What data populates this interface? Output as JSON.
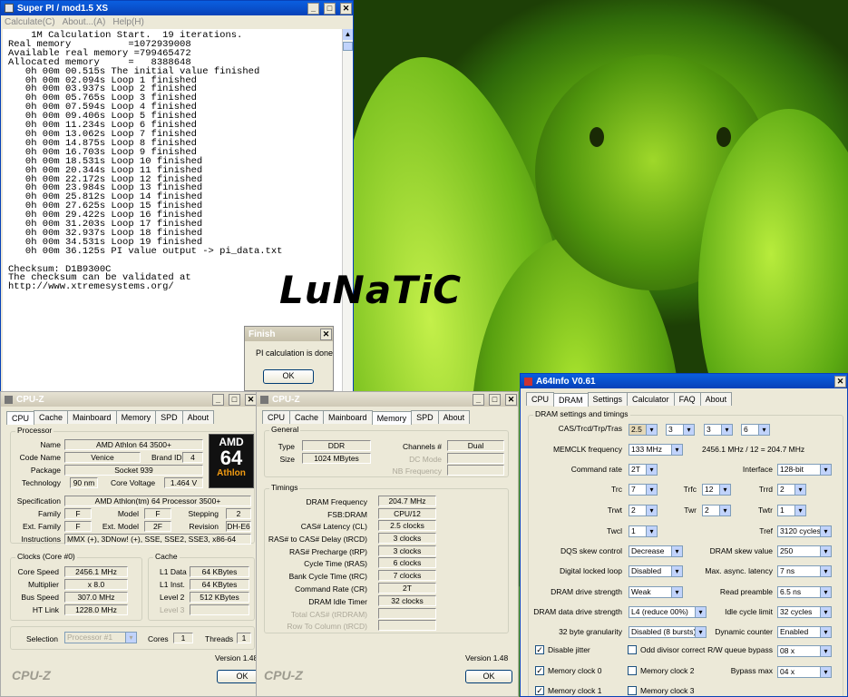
{
  "overlay_text": "LuNaTiC",
  "superpi": {
    "title": "Super PI / mod1.5 XS",
    "menu": [
      "Calculate(C)",
      "About...(A)",
      "Help(H)"
    ],
    "log": "    1M Calculation Start.  19 iterations.\nReal memory          =1072939008\nAvailable real memory =799465472\nAllocated memory     =   8388648\n   0h 00m 00.515s The initial value finished\n   0h 00m 02.094s Loop 1 finished\n   0h 00m 03.937s Loop 2 finished\n   0h 00m 05.765s Loop 3 finished\n   0h 00m 07.594s Loop 4 finished\n   0h 00m 09.406s Loop 5 finished\n   0h 00m 11.234s Loop 6 finished\n   0h 00m 13.062s Loop 7 finished\n   0h 00m 14.875s Loop 8 finished\n   0h 00m 16.703s Loop 9 finished\n   0h 00m 18.531s Loop 10 finished\n   0h 00m 20.344s Loop 11 finished\n   0h 00m 22.172s Loop 12 finished\n   0h 00m 23.984s Loop 13 finished\n   0h 00m 25.812s Loop 14 finished\n   0h 00m 27.625s Loop 15 finished\n   0h 00m 29.422s Loop 16 finished\n   0h 00m 31.203s Loop 17 finished\n   0h 00m 32.937s Loop 18 finished\n   0h 00m 34.531s Loop 19 finished\n   0h 00m 36.125s PI value output -> pi_data.txt\n\nChecksum: D1B9300C\nThe checksum can be validated at\nhttp://www.xtremesystems.org/"
  },
  "finish_dialog": {
    "title": "Finish",
    "message": "PI calculation is done!",
    "ok": "OK"
  },
  "cpuz1": {
    "title": "CPU-Z",
    "tabs": [
      "CPU",
      "Cache",
      "Mainboard",
      "Memory",
      "SPD",
      "About"
    ],
    "processor_group": "Processor",
    "name_label": "Name",
    "name": "AMD Athlon 64 3500+",
    "codename_label": "Code Name",
    "codename": "Venice",
    "brandid_label": "Brand ID",
    "brandid": "4",
    "package_label": "Package",
    "package": "Socket 939",
    "tech_label": "Technology",
    "tech": "90 nm",
    "voltage_label": "Core Voltage",
    "voltage": "1.464 V",
    "spec_label": "Specification",
    "spec": "AMD Athlon(tm) 64 Processor 3500+",
    "family_label": "Family",
    "family": "F",
    "model_label": "Model",
    "model": "F",
    "stepping_label": "Stepping",
    "stepping": "2",
    "extfamily_label": "Ext. Family",
    "extfamily": "F",
    "extmodel_label": "Ext. Model",
    "extmodel": "2F",
    "revision_label": "Revision",
    "revision": "DH-E6",
    "instr_label": "Instructions",
    "instr": "MMX (+), 3DNow! (+), SSE, SSE2, SSE3, x86-64",
    "clocks_group": "Clocks (Core #0)",
    "corespeed_label": "Core Speed",
    "corespeed": "2456.1 MHz",
    "mult_label": "Multiplier",
    "mult": "x 8.0",
    "bus_label": "Bus Speed",
    "bus": "307.0 MHz",
    "ht_label": "HT Link",
    "ht": "1228.0 MHz",
    "cache_group": "Cache",
    "l1d_label": "L1 Data",
    "l1d": "64 KBytes",
    "l1i_label": "L1 Inst.",
    "l1i": "64 KBytes",
    "l2_label": "Level 2",
    "l2": "512 KBytes",
    "l3_label": "Level 3",
    "selection_label": "Selection",
    "selection": "Processor #1",
    "cores_label": "Cores",
    "cores": "1",
    "threads_label": "Threads",
    "threads": "1",
    "version": "Version 1.48",
    "brand_logo": "CPU-Z",
    "ok": "OK",
    "amd_text": "AMD",
    "amd_num": "64",
    "amd_athlon": "Athlon"
  },
  "cpuz2": {
    "title": "CPU-Z",
    "tabs": [
      "CPU",
      "Cache",
      "Mainboard",
      "Memory",
      "SPD",
      "About"
    ],
    "general_group": "General",
    "type_label": "Type",
    "type": "DDR",
    "size_label": "Size",
    "size": "1024 MBytes",
    "channels_label": "Channels #",
    "channels": "Dual",
    "dcmode_label": "DC Mode",
    "nbfreq_label": "NB Frequency",
    "timings_group": "Timings",
    "dramfreq_label": "DRAM Frequency",
    "dramfreq": "204.7 MHz",
    "fsb_label": "FSB:DRAM",
    "fsb": "CPU/12",
    "cas_label": "CAS# Latency (CL)",
    "cas": "2.5 clocks",
    "trcd_label": "RAS# to CAS# Delay (tRCD)",
    "trcd": "3 clocks",
    "trp_label": "RAS# Precharge (tRP)",
    "trp": "3 clocks",
    "tras_label": "Cycle Time (tRAS)",
    "tras": "6 clocks",
    "trc_label": "Bank Cycle Time (tRC)",
    "trc": "7 clocks",
    "cr_label": "Command Rate (CR)",
    "cr": "2T",
    "idle_label": "DRAM Idle Timer",
    "idle": "32 clocks",
    "tcas_label": "Total CAS# (tRDRAM)",
    "rowcol_label": "Row To Column (tRCD)",
    "version": "Version 1.48",
    "brand_logo": "CPU-Z",
    "ok": "OK"
  },
  "a64": {
    "title": "A64Info V0.61",
    "tabs": [
      "CPU",
      "DRAM",
      "Settings",
      "Calculator",
      "FAQ",
      "About"
    ],
    "group": "DRAM settings and timings",
    "cas_label": "CAS/Trcd/Trp/Tras",
    "cas": "2.5",
    "trcd": "3",
    "trp": "3",
    "tras": "6",
    "memclk_label": "MEMCLK frequency",
    "memclk": "133 MHz",
    "memclk_calc": "2456.1 MHz / 12 = 204.7 MHz",
    "cmdrate_label": "Command rate",
    "cmdrate": "2T",
    "interface_label": "Interface",
    "interface": "128-bit",
    "trc_label": "Trc",
    "trc": "7",
    "trfc_label": "Trfc",
    "trfc": "12",
    "trrd_label": "Trrd",
    "trrd": "2",
    "trwt_label": "Trwt",
    "trwt": "2",
    "twr_label": "Twr",
    "twr": "2",
    "twtr_label": "Twtr",
    "twtr": "1",
    "twcl_label": "Twcl",
    "twcl": "1",
    "tref_label": "Tref",
    "tref": "3120 cycles",
    "dqs_label": "DQS skew control",
    "dqs": "Decrease",
    "dramskew_label": "DRAM skew value",
    "dramskew": "250",
    "dll_label": "Digital locked loop",
    "dll": "Disabled",
    "async_label": "Max. async. latency",
    "async": "7 ns",
    "drive_label": "DRAM drive strength",
    "drive": "Weak",
    "preamble_label": "Read preamble",
    "preamble": "6.5 ns",
    "datadrive_label": "DRAM data drive strength",
    "datadrive": "L4 (reduce 00%)",
    "idle_label": "Idle cycle limit",
    "idle": "32 cycles",
    "gran_label": "32 byte granularity",
    "gran": "Disabled (8 bursts)",
    "dyn_label": "Dynamic counter",
    "dyn": "Enabled",
    "jitter_label": "Disable jitter",
    "oddiv_label": "Odd divisor correct",
    "rwq_label": "R/W queue bypass",
    "rwq": "08 x",
    "mc0_label": "Memory clock 0",
    "mc2_label": "Memory clock 2",
    "bypass_label": "Bypass max",
    "bypass": "04 x",
    "mc1_label": "Memory clock 1",
    "mc3_label": "Memory clock 3"
  }
}
